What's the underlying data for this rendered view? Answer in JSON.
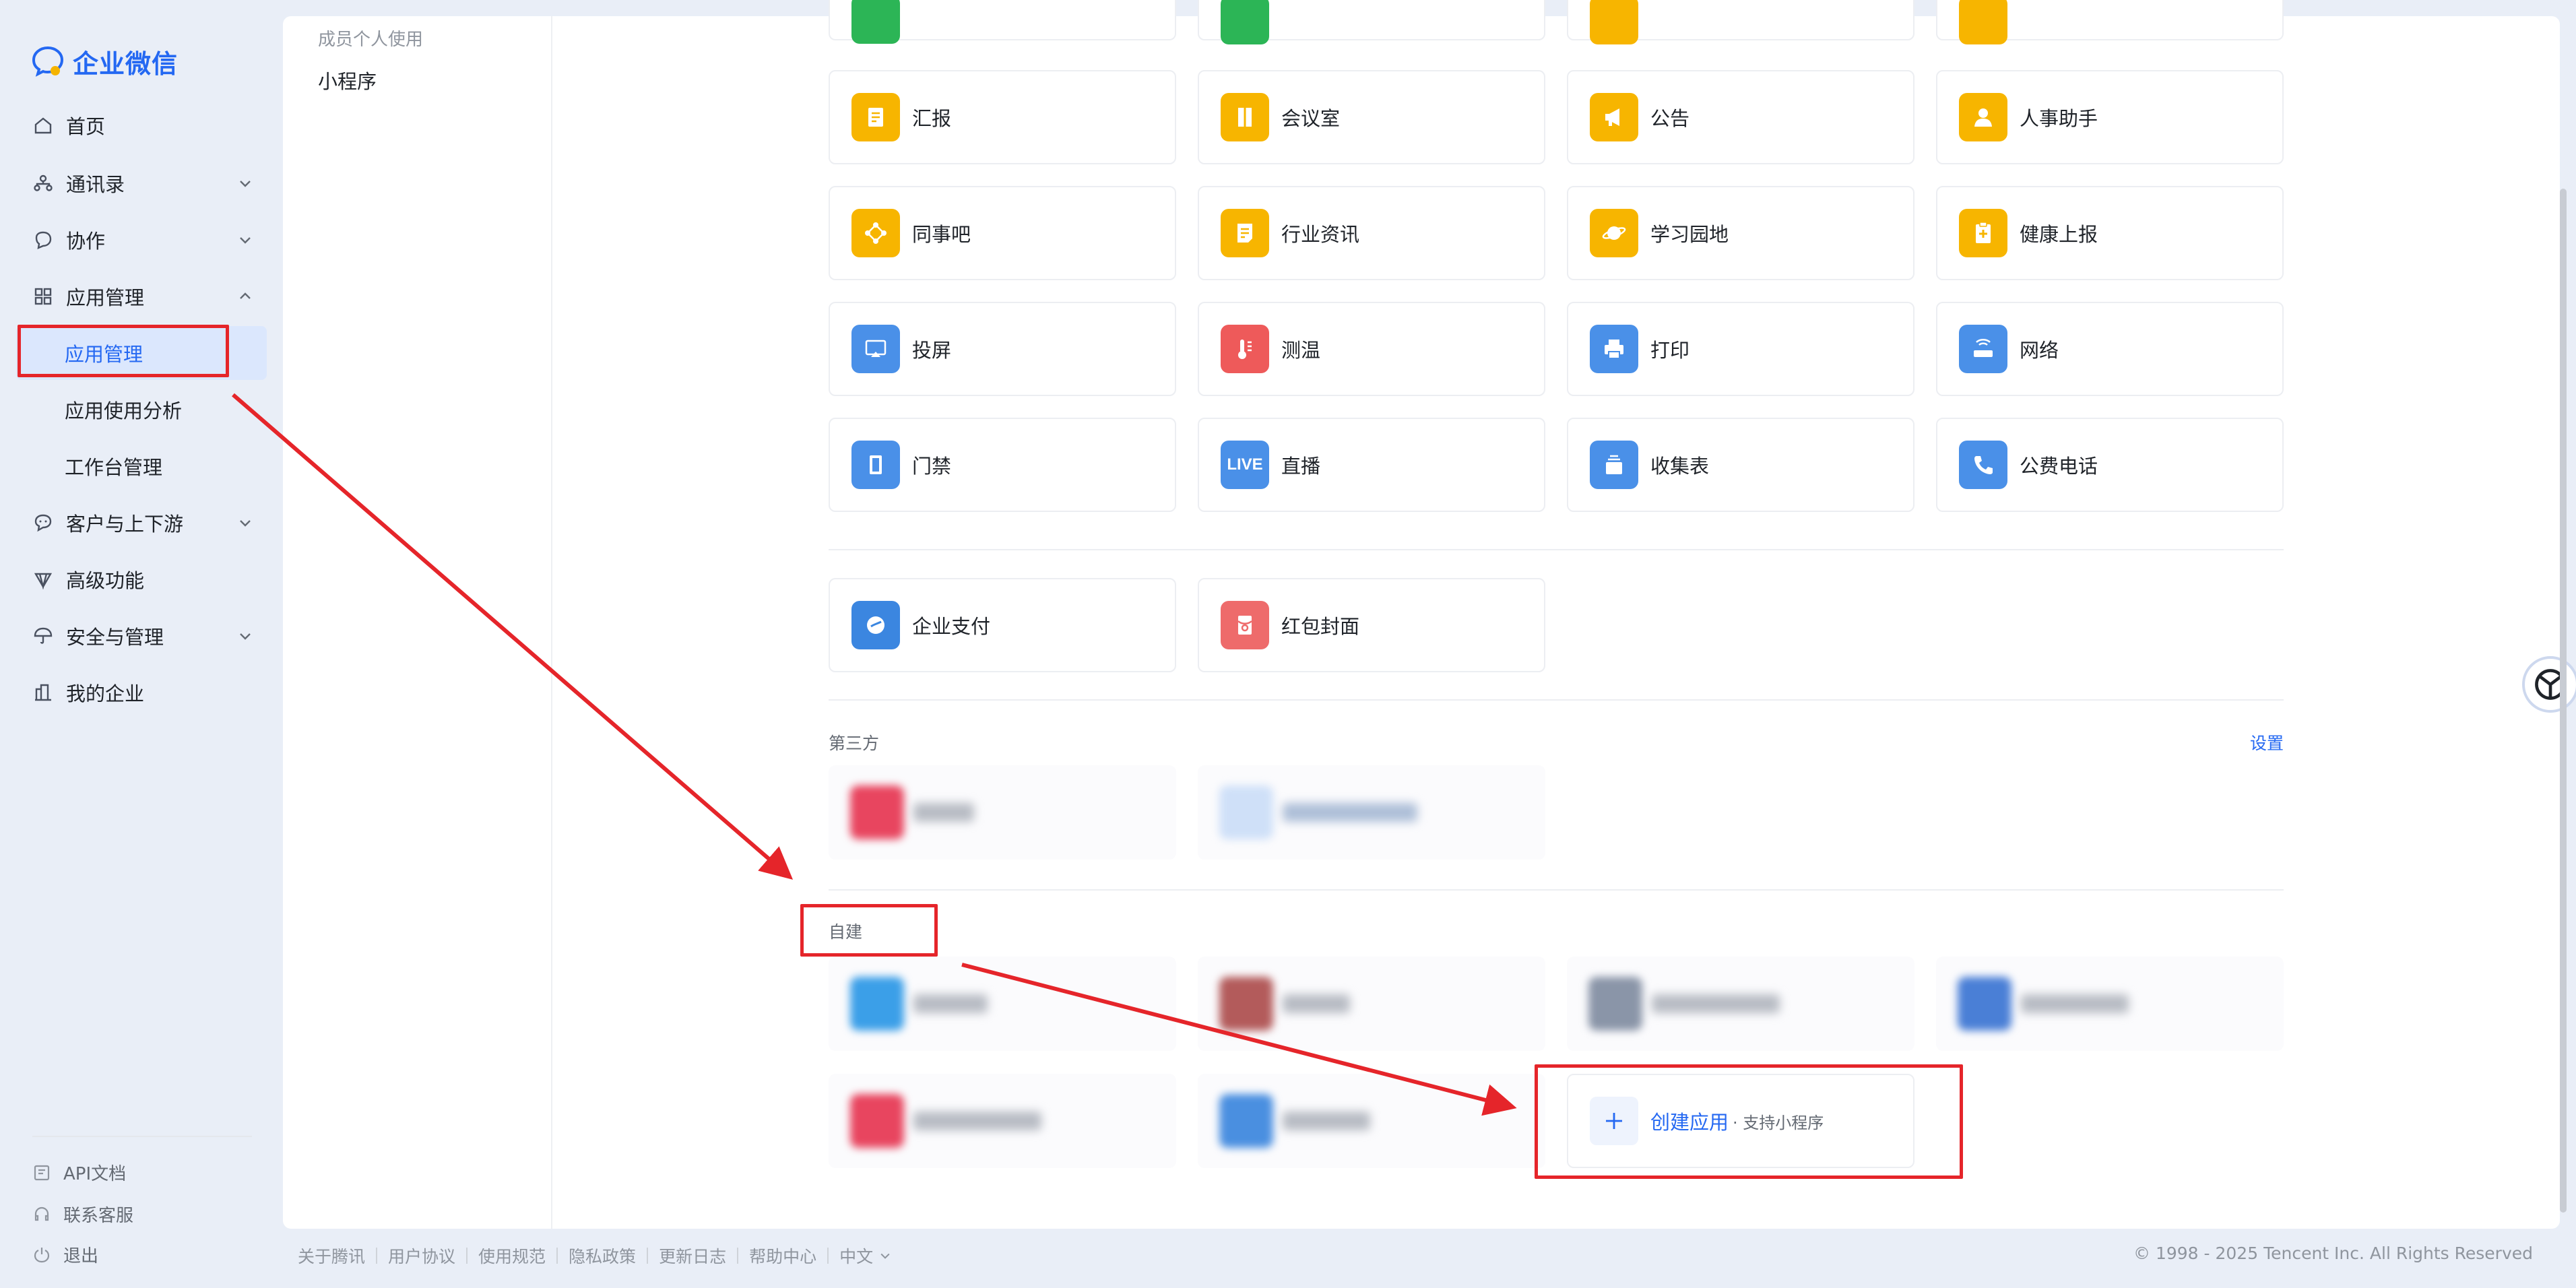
{
  "brand": {
    "name": "企业微信",
    "accent": "#2468f2"
  },
  "sidebar": {
    "items": [
      {
        "label": "首页",
        "icon": "home-icon"
      },
      {
        "label": "通讯录",
        "icon": "contacts-icon"
      },
      {
        "label": "协作",
        "icon": "collaboration-icon"
      },
      {
        "label": "应用管理",
        "icon": "apps-grid-icon"
      },
      {
        "label": "客户与上下游",
        "icon": "chat-icon"
      },
      {
        "label": "高级功能",
        "icon": "diamond-icon"
      },
      {
        "label": "安全与管理",
        "icon": "umbrella-icon"
      },
      {
        "label": "我的企业",
        "icon": "building-icon"
      }
    ],
    "sub_items": [
      "应用管理",
      "应用使用分析",
      "工作台管理"
    ],
    "footer": [
      "API文档",
      "联系客服",
      "退出"
    ]
  },
  "subnav": {
    "title": "成员个人使用",
    "item": "小程序"
  },
  "apps": [
    {
      "label": "汇报",
      "color": "#f7b500",
      "icon": "report-icon"
    },
    {
      "label": "会议室",
      "color": "#f7b500",
      "icon": "door-icon"
    },
    {
      "label": "公告",
      "color": "#f7b500",
      "icon": "megaphone-icon"
    },
    {
      "label": "人事助手",
      "color": "#f7b500",
      "icon": "person-icon"
    },
    {
      "label": "同事吧",
      "color": "#f7b500",
      "icon": "share-icon"
    },
    {
      "label": "行业资讯",
      "color": "#f7b500",
      "icon": "news-icon"
    },
    {
      "label": "学习园地",
      "color": "#f7b500",
      "icon": "planet-icon"
    },
    {
      "label": "健康上报",
      "color": "#f7b500",
      "icon": "clipboard-plus-icon"
    },
    {
      "label": "投屏",
      "color": "#4a90e8",
      "icon": "screen-cast-icon"
    },
    {
      "label": "测温",
      "color": "#ee5a5a",
      "icon": "thermometer-icon"
    },
    {
      "label": "打印",
      "color": "#4a90e8",
      "icon": "printer-icon"
    },
    {
      "label": "网络",
      "color": "#4a90e8",
      "icon": "router-icon"
    },
    {
      "label": "门禁",
      "color": "#4a90e8",
      "icon": "door-access-icon"
    },
    {
      "label": "直播",
      "color": "#4a90e8",
      "icon": "live-icon",
      "badge": "LIVE"
    },
    {
      "label": "收集表",
      "color": "#4a90e8",
      "icon": "form-stack-icon"
    },
    {
      "label": "公费电话",
      "color": "#4a90e8",
      "icon": "phone-icon"
    }
  ],
  "payment_apps": [
    {
      "label": "企业支付",
      "color": "#3b86e0",
      "icon": "wallet-icon"
    },
    {
      "label": "红包封面",
      "color": "#ee6b6b",
      "icon": "red-packet-icon"
    }
  ],
  "third_party": {
    "title": "第三方",
    "settings": "设置"
  },
  "custom": {
    "title": "自建",
    "create_label": "创建应用",
    "create_sub": "· 支持小程序"
  },
  "footer": {
    "links": [
      "关于腾讯",
      "用户协议",
      "使用规范",
      "隐私政策",
      "更新日志",
      "帮助中心",
      "中文"
    ],
    "copyright": "© 1998 - 2025 Tencent Inc. All Rights Reserved"
  }
}
